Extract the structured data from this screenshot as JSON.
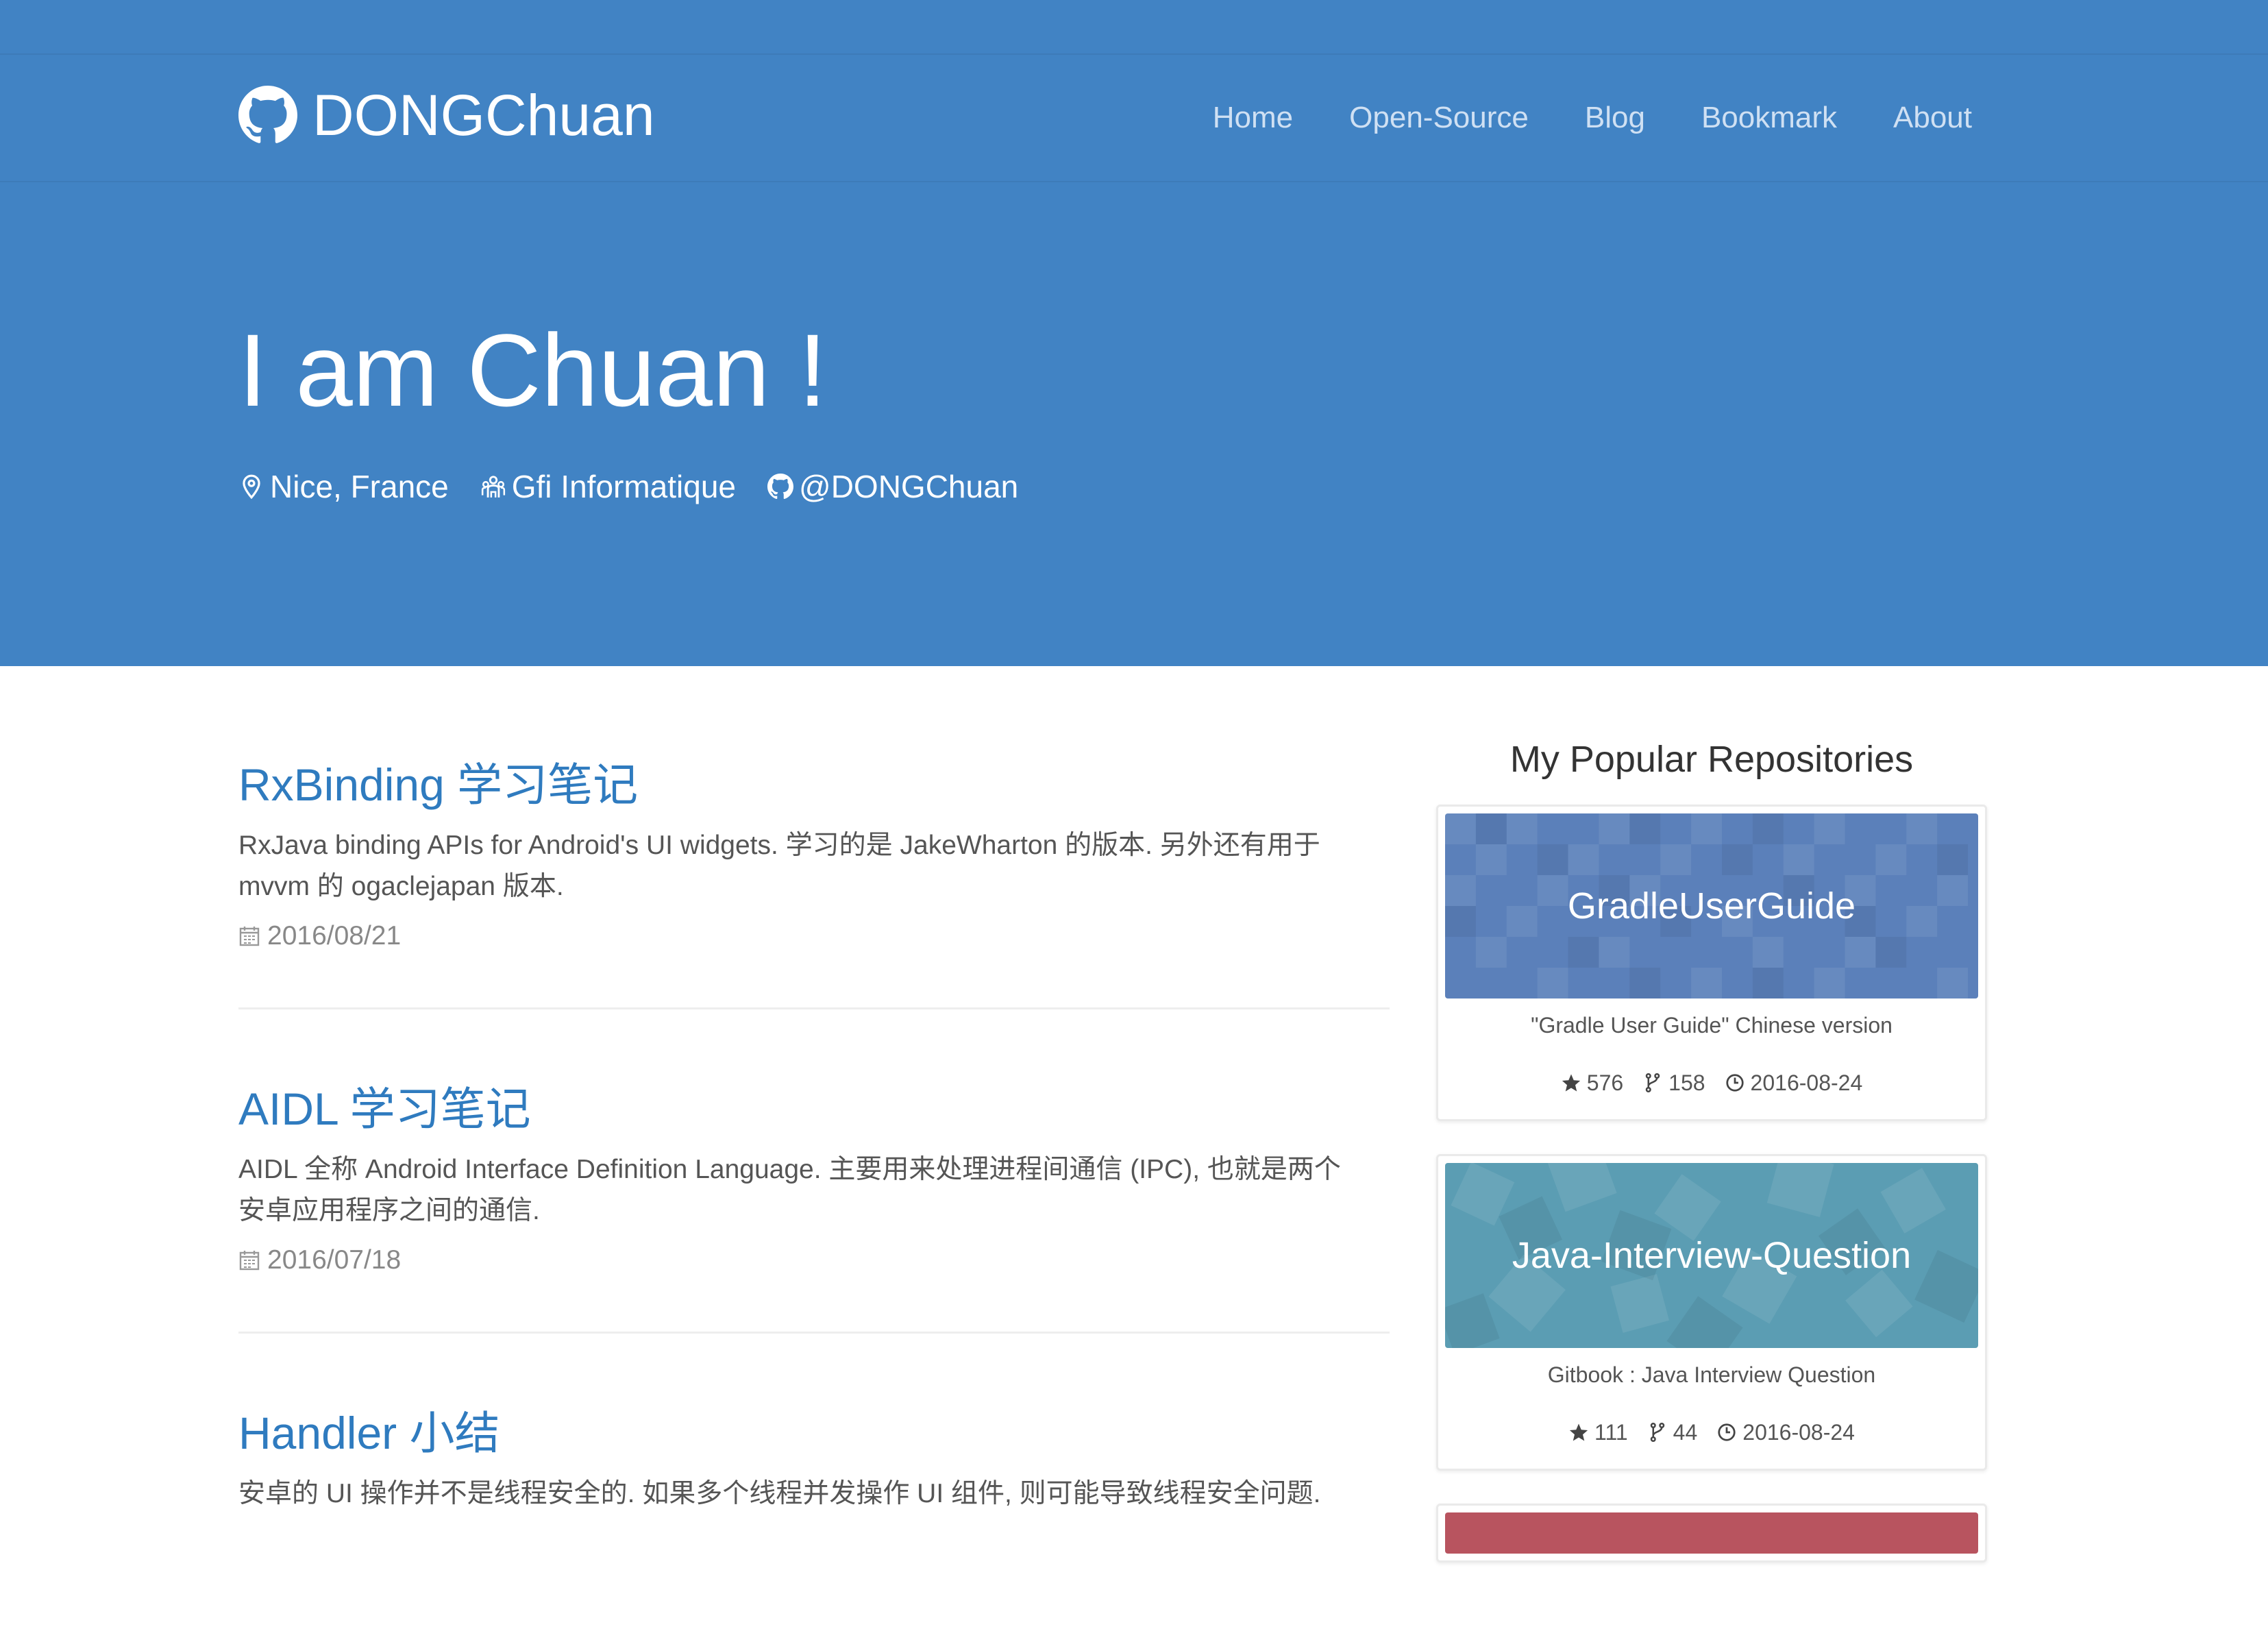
{
  "colors": {
    "hero_bg": "#4183c4",
    "link": "#2f7bbf",
    "repo1_banner": "#5b80ba",
    "repo2_banner": "#5b9db3",
    "repo3_banner": "#b8545f"
  },
  "header": {
    "brand_icon": "github-icon",
    "brand": "DONGChuan",
    "nav": [
      "Home",
      "Open-Source",
      "Blog",
      "Bookmark",
      "About"
    ]
  },
  "hero": {
    "title": "I am Chuan !",
    "location_icon": "map-pin-icon",
    "location": "Nice, France",
    "company_icon": "organization-icon",
    "company": "Gfi Informatique",
    "github_icon": "github-icon",
    "github": "@DONGChuan"
  },
  "posts": [
    {
      "title": "RxBinding 学习笔记",
      "desc_line1": "RxJava binding APIs for Android's UI widgets. 学习的是 JakeWharton 的版本. 另外还有用于",
      "desc_line2": "mvvm 的 ogaclejapan 版本.",
      "date": "2016/08/21"
    },
    {
      "title": "AIDL 学习笔记",
      "desc_line1": "AIDL 全称 Android Interface Definition Language. 主要用来处理进程间通信 (IPC), 也就是两个",
      "desc_line2": "安卓应用程序之间的通信.",
      "date": "2016/07/18"
    },
    {
      "title": "Handler 小结",
      "desc_line1": "安卓的 UI 操作并不是线程安全的. 如果多个线程并发操作 UI 组件, 则可能导致线程安全问题."
    }
  ],
  "sidebar": {
    "title": "My Popular Repositories",
    "repos": [
      {
        "name": "GradleUserGuide",
        "desc": "\"Gradle User Guide\" Chinese version",
        "stars": "576",
        "forks": "158",
        "updated": "2016-08-24"
      },
      {
        "name": "Java-Interview-Question",
        "desc": "Gitbook : Java Interview Question",
        "stars": "111",
        "forks": "44",
        "updated": "2016-08-24"
      }
    ]
  }
}
